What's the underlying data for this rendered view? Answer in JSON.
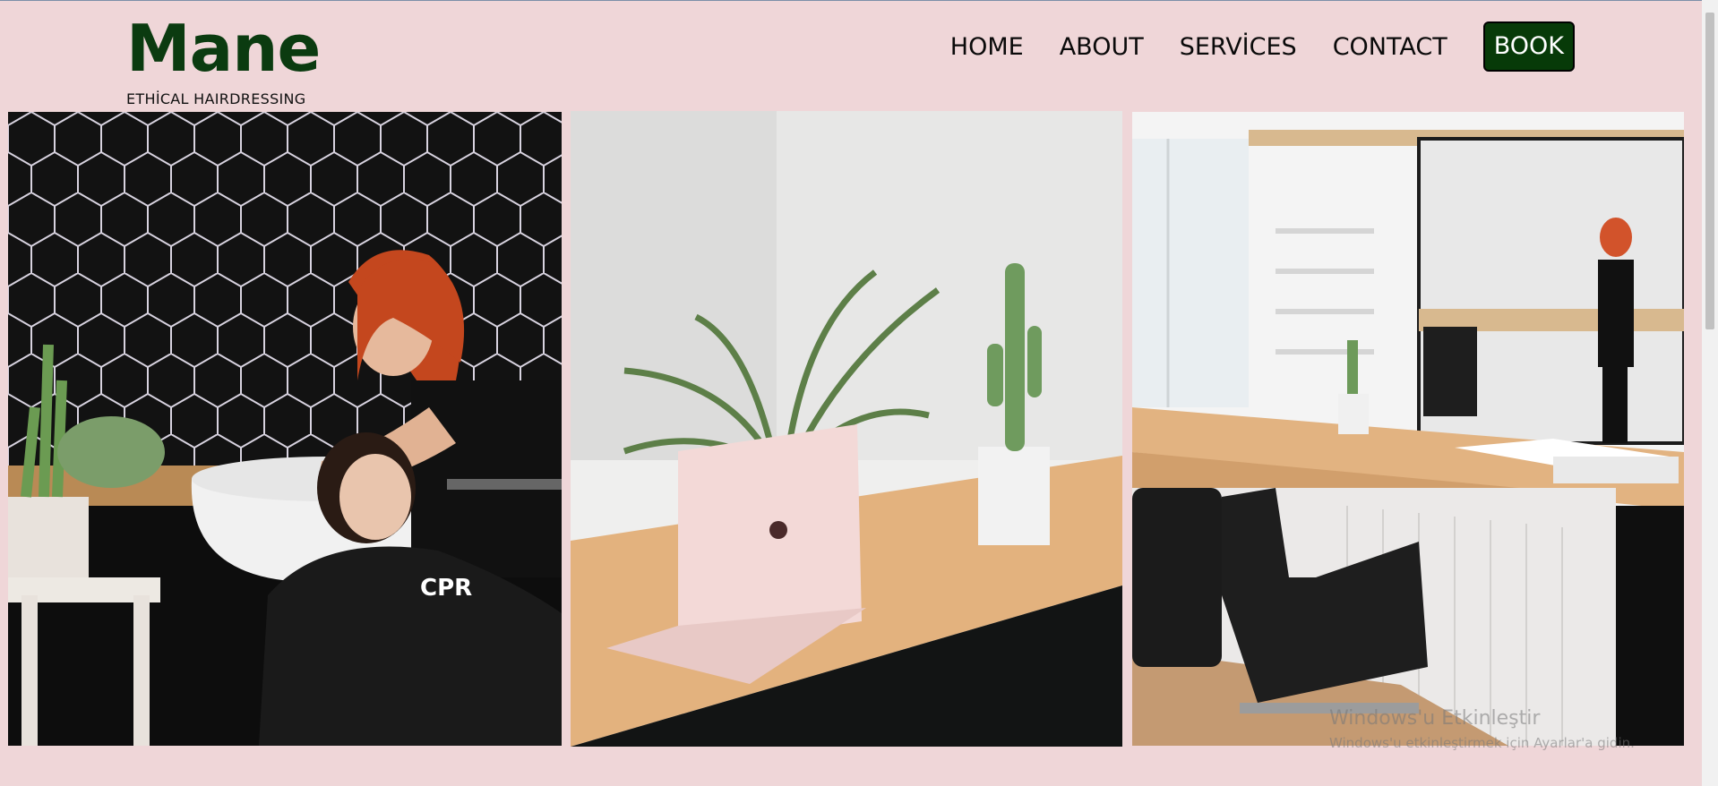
{
  "brand": {
    "name": "Mane",
    "tagline": "ETHİCAL HAIRDRESSING"
  },
  "nav": {
    "items": [
      "HOME",
      "ABOUT",
      "SERVİCES",
      "CONTACT"
    ],
    "book_label": "BOOK"
  },
  "gallery": {
    "images": [
      {
        "name": "salon-wash-photo",
        "cape_text": "CPR"
      },
      {
        "name": "desk-laptop-photo"
      },
      {
        "name": "salon-interior-photo"
      }
    ]
  },
  "watermark": {
    "title": "Windows'u Etkinleştir",
    "subtitle": "Windows'u etkinleştirmek için Ayarlar'a gidin."
  },
  "colors": {
    "background": "#efd6d8",
    "brand_green": "#0b3b10",
    "book_button": "#073a08"
  }
}
